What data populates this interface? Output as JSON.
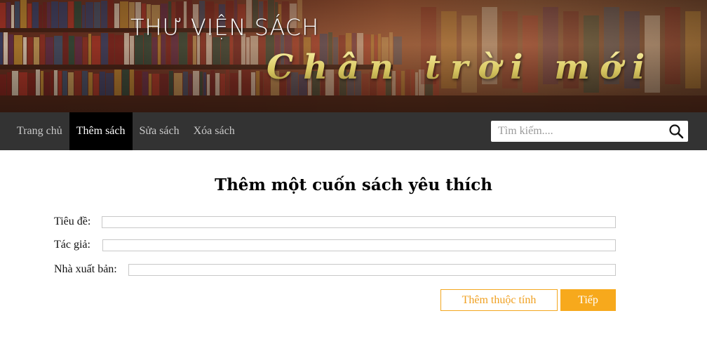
{
  "header": {
    "site_title": "THƯ VIỆN SÁCH",
    "slogan": "Chân trời mới"
  },
  "nav": {
    "items": [
      {
        "label": "Trang chủ",
        "active": false
      },
      {
        "label": "Thêm sách",
        "active": true
      },
      {
        "label": "Sửa sách",
        "active": false
      },
      {
        "label": "Xóa sách",
        "active": false
      }
    ],
    "search": {
      "placeholder": "Tìm kiếm....",
      "value": "",
      "icon": "search-icon"
    }
  },
  "form": {
    "title": "Thêm một cuốn sách yêu thích",
    "fields": {
      "title": {
        "label": "Tiêu đề:",
        "value": ""
      },
      "author": {
        "label": "Tác giả:",
        "value": ""
      },
      "publisher": {
        "label": "Nhà xuất bản:",
        "value": ""
      }
    },
    "buttons": {
      "add_attribute": "Thêm thuộc tính",
      "next": "Tiếp"
    }
  },
  "colors": {
    "nav_bg": "#333333",
    "nav_active_bg": "#000000",
    "accent": "#f7a91c"
  }
}
